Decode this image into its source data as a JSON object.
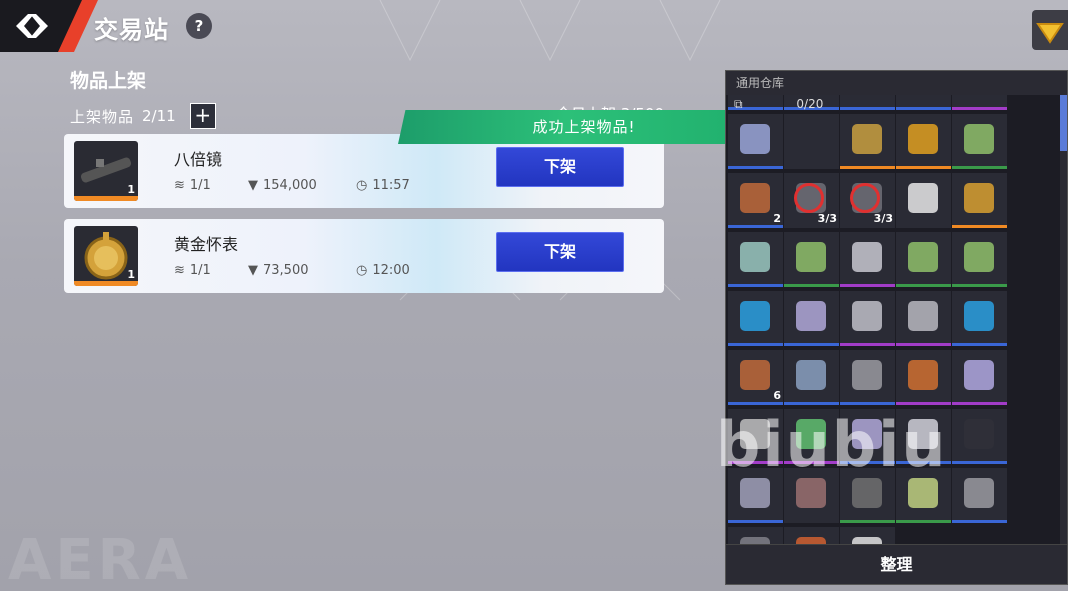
{
  "header": {
    "title": "交易站",
    "help_label": "?"
  },
  "listing": {
    "section_title": "物品上架",
    "listed_label": "上架物品",
    "listed_count": "2/11",
    "add_label": "+",
    "daily_label": "今日上架 3/500"
  },
  "toast": {
    "text": "成功上架物品!"
  },
  "items": [
    {
      "name": "八倍镜",
      "qty": "1",
      "stock": "1/1",
      "price": "154,000",
      "time": "11:57",
      "action": "下架",
      "rarity": "#f08a24"
    },
    {
      "name": "黄金怀表",
      "qty": "1",
      "stock": "1/1",
      "price": "73,500",
      "time": "12:00",
      "action": "下架",
      "rarity": "#f08a24"
    }
  ],
  "warehouse": {
    "title": "通用仓库",
    "slots": "0/20",
    "sort_label": "整理",
    "cells": [
      {
        "icon": "item-icon",
        "rarity": "#3a66d6",
        "count": ""
      },
      {
        "icon": "item-icon",
        "rarity": "#3a66d6",
        "count": ""
      },
      {
        "icon": "item-icon",
        "rarity": "#3a66d6",
        "count": ""
      },
      {
        "icon": "item-icon",
        "rarity": "#3a66d6",
        "count": ""
      },
      {
        "icon": "item-icon",
        "rarity": "#a23cc8",
        "count": ""
      },
      {
        "icon": "phone-icon",
        "rarity": "#3a66d6",
        "count": ""
      },
      {
        "icon": "empty",
        "rarity": "",
        "count": ""
      },
      {
        "icon": "shell-icon",
        "rarity": "#f08a24",
        "count": ""
      },
      {
        "icon": "gold-bar-icon",
        "rarity": "#f08a24",
        "count": ""
      },
      {
        "icon": "cash-icon",
        "rarity": "#3a9a4a",
        "count": ""
      },
      {
        "icon": "core-icon",
        "rarity": "#3a66d6",
        "count": "2"
      },
      {
        "icon": "banned-item-icon",
        "rarity": "",
        "count": "3/3"
      },
      {
        "icon": "banned-item-icon",
        "rarity": "",
        "count": "3/3"
      },
      {
        "icon": "document-icon",
        "rarity": "",
        "count": ""
      },
      {
        "icon": "dumbbell-icon",
        "rarity": "#f08a24",
        "count": ""
      },
      {
        "icon": "battery-icon",
        "rarity": "#3a66d6",
        "count": ""
      },
      {
        "icon": "cash-icon",
        "rarity": "#3a9a4a",
        "count": ""
      },
      {
        "icon": "goblet-icon",
        "rarity": "#a23cc8",
        "count": ""
      },
      {
        "icon": "cash-icon",
        "rarity": "#3a9a4a",
        "count": ""
      },
      {
        "icon": "cash-icon",
        "rarity": "#3a9a4a",
        "count": ""
      },
      {
        "icon": "device-icon",
        "rarity": "#3a66d6",
        "count": ""
      },
      {
        "icon": "straws-icon",
        "rarity": "#3a66d6",
        "count": ""
      },
      {
        "icon": "tray-icon",
        "rarity": "#a23cc8",
        "count": ""
      },
      {
        "icon": "comb-icon",
        "rarity": "#a23cc8",
        "count": ""
      },
      {
        "icon": "device-icon",
        "rarity": "#3a66d6",
        "count": ""
      },
      {
        "icon": "core-icon",
        "rarity": "#3a66d6",
        "count": "6"
      },
      {
        "icon": "cpu-icon",
        "rarity": "#3a66d6",
        "count": ""
      },
      {
        "icon": "motor-icon",
        "rarity": "#3a66d6",
        "count": ""
      },
      {
        "icon": "bottle-icon",
        "rarity": "#a23cc8",
        "count": ""
      },
      {
        "icon": "cloth-icon",
        "rarity": "#a23cc8",
        "count": ""
      },
      {
        "icon": "circuit-icon",
        "rarity": "#a23cc8",
        "count": ""
      },
      {
        "icon": "ram-icon",
        "rarity": "#a23cc8",
        "count": ""
      },
      {
        "icon": "straws-icon",
        "rarity": "#3a66d6",
        "count": ""
      },
      {
        "icon": "pen-icon",
        "rarity": "#3a66d6",
        "count": ""
      },
      {
        "icon": "router-icon",
        "rarity": "#3a66d6",
        "count": ""
      },
      {
        "icon": "jar-icon",
        "rarity": "#3a66d6",
        "count": ""
      },
      {
        "icon": "guitar-icon",
        "rarity": "",
        "count": ""
      },
      {
        "icon": "gauge-icon",
        "rarity": "#3a9a4a",
        "count": ""
      },
      {
        "icon": "meter-icon",
        "rarity": "#3a9a4a",
        "count": ""
      },
      {
        "icon": "motor-icon",
        "rarity": "#3a66d6",
        "count": ""
      },
      {
        "icon": "rods-icon",
        "rarity": "#3a66d6",
        "count": ""
      },
      {
        "icon": "cube-icon",
        "rarity": "#3a66d6",
        "count": ""
      },
      {
        "icon": "paper-icon",
        "rarity": "#3a66d6",
        "count": ""
      }
    ]
  },
  "watermark": "biubiu",
  "bg_logo": "AERA"
}
